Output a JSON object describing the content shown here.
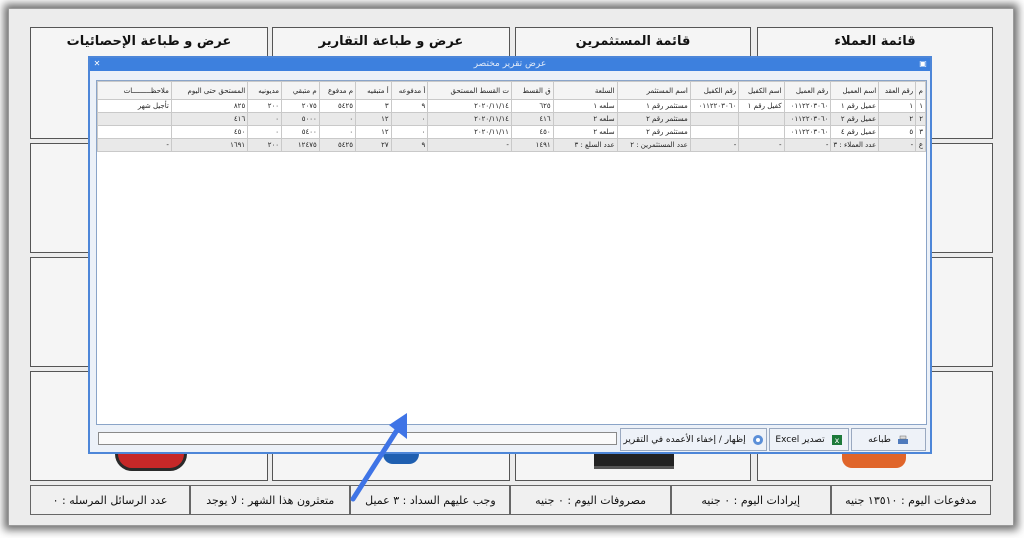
{
  "cards": {
    "customers": "قائمة العملاء",
    "investors": "قائمة المستثمرين",
    "reports": "عرض و طباعة التقارير",
    "statistics": "عرض و طباعة الإحصائيات"
  },
  "status_bar": [
    "مدفوعات اليوم : ١٣٥١٠ جنيه",
    "إيرادات اليوم : ٠ جنيه",
    "مصروفات اليوم : ٠ جنيه",
    "وجب عليهم السداد : ٣ عميل",
    "متعثرون هذا الشهر : لا يوجد",
    "عدد الرسائل المرسله : ٠"
  ],
  "dialog": {
    "title": "عرض تقرير مختصر",
    "print_label": "طباعه",
    "export_label": "تصدير Excel",
    "columns_label": "إظهار / إخفاء الأعمده في التقرير"
  },
  "table": {
    "headers": [
      "م",
      "رقم العقد",
      "اسم العميل",
      "رقم العميل",
      "اسم الكفيل",
      "رقم الكفيل",
      "اسم المستثمر",
      "السلعة",
      "ق القسط",
      "ت القسط المستحق",
      "أ مدفوعه",
      "أ متبقيه",
      "م مدفوع",
      "م متبقي",
      "مديونيه",
      "المستحق حتى اليوم",
      "ملاحظـــــــــات"
    ],
    "rows": [
      [
        "١",
        "١",
        "عميل رقم ١",
        "٠١١٢٢٠٣٠٦٠",
        "كفيل رقم ١",
        "٠١١٢٢٠٣٠٦٠",
        "مستثمر رقم ١",
        "سلعه ١",
        "٦٢٥",
        "٢٠٢٠/١١/١٤",
        "٩",
        "٣",
        "٥٤٢٥",
        "٢٠٧٥",
        "٢٠٠",
        "٨٢٥",
        "تأجيل شهر"
      ],
      [
        "٢",
        "٢",
        "عميل رقم ٢",
        "٠١١٢٢٠٣٠٦٠",
        "",
        "",
        "مستثمر رقم ٢",
        "سلعه ٢",
        "٤١٦",
        "٢٠٢٠/١١/١٤",
        "٠",
        "١٢",
        "٠",
        "٥٠٠٠",
        "٠",
        "٤١٦",
        ""
      ],
      [
        "٣",
        "٥",
        "عميل رقم ٤",
        "٠١١٢٢٠٣٠٦٠",
        "",
        "",
        "مستثمر رقم ٢",
        "سلعه ٢",
        "٤٥٠",
        "٢٠٢٠/١١/١١",
        "٠",
        "١٢",
        "٠",
        "٥٤٠٠",
        "٠",
        "٤٥٠",
        ""
      ],
      [
        "ع",
        "-",
        "عدد العملاء : ٣",
        "-",
        "-",
        "-",
        "عدد المستثمرين : ٢",
        "عدد السلع : ٣",
        "١٤٩١",
        "-",
        "٩",
        "٢٧",
        "٥٤٢٥",
        "١٢٤٧٥",
        "٢٠٠",
        "١٦٩١",
        "-"
      ]
    ]
  },
  "colors": {
    "title_bar": "#3d80de",
    "dialog_border": "#4d86d8",
    "arrow": "#3f74e6"
  }
}
